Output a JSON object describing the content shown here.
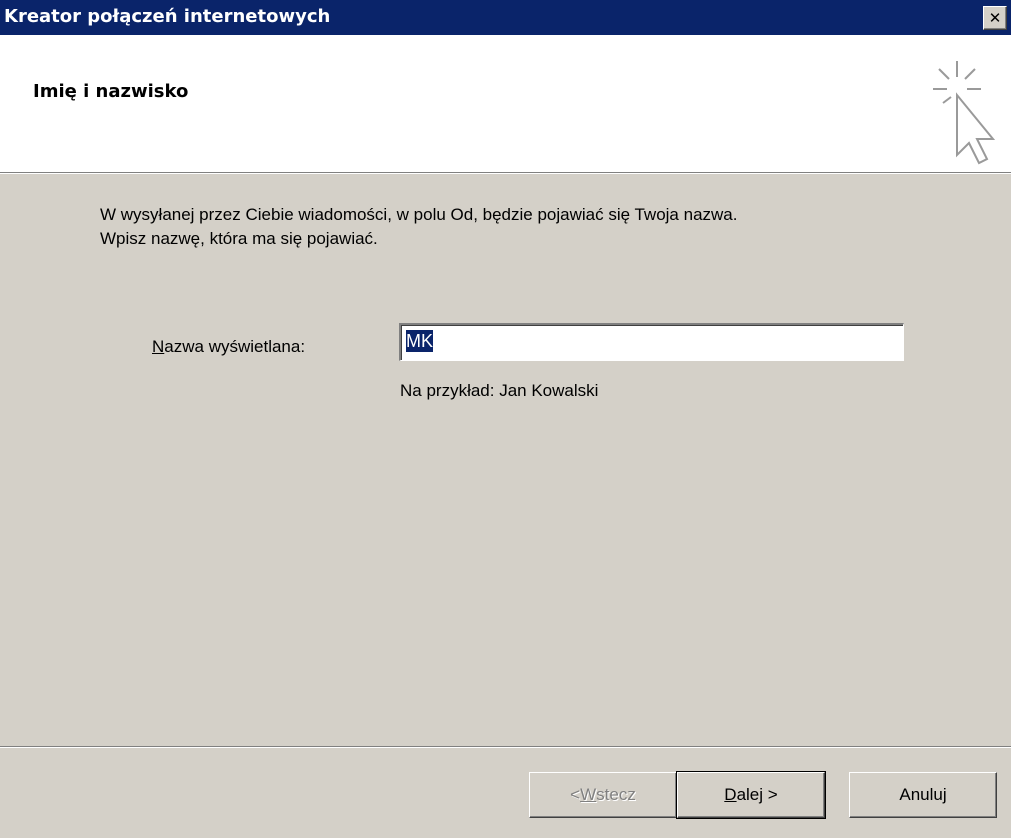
{
  "window": {
    "title": "Kreator połączeń internetowych",
    "close_label": "✕"
  },
  "header": {
    "heading": "Imię i nazwisko",
    "icon": "wizard-cursor-icon"
  },
  "content": {
    "description_line1": "W wysyłanej przez Ciebie wiadomości, w polu Od, będzie pojawiać się Twoja nazwa.",
    "description_line2": "Wpisz nazwę, która ma się pojawiać.",
    "field_label_mnemonic": "N",
    "field_label_rest": "azwa wyświetlana:",
    "field_value": "MK",
    "example": "Na przykład: Jan Kowalski"
  },
  "buttons": {
    "back_prefix": "< ",
    "back_mnemonic": "W",
    "back_rest": "stecz",
    "next_mnemonic": "D",
    "next_rest": "alej >",
    "cancel": "Anuluj"
  },
  "colors": {
    "titlebar": "#0a246a",
    "dialog": "#d4d0c8",
    "header": "#ffffff",
    "selection": "#0a246a"
  }
}
